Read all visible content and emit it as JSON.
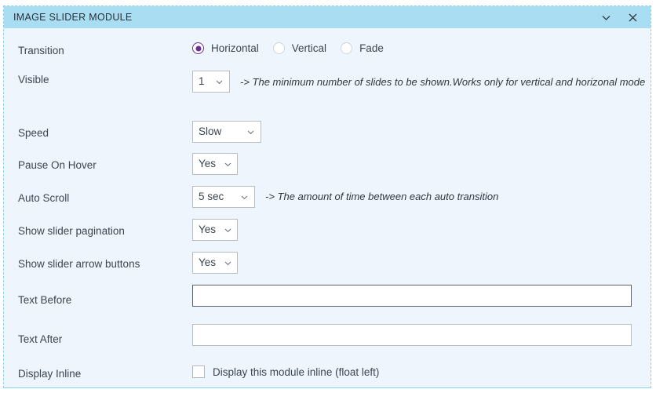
{
  "panel": {
    "title": "IMAGE SLIDER MODULE",
    "header_bg": "#a8ddf2",
    "body_bg": "#eef5fd",
    "border_color": "#8ed2ef",
    "accent_color": "#6d2f8f",
    "actions": [
      {
        "name": "collapse-icon",
        "glyph": "chevron-down"
      },
      {
        "name": "close-icon",
        "glyph": "close-x"
      }
    ]
  },
  "rows": {
    "transition": {
      "label": "Transition",
      "options": [
        {
          "label": "Horizontal",
          "checked": true
        },
        {
          "label": "Vertical",
          "checked": false
        },
        {
          "label": "Fade",
          "checked": false
        }
      ]
    },
    "visible": {
      "label": "Visible",
      "value": "1",
      "help": "-> The minimum number of slides to be shown.Works only for vertical and horizonal mode"
    },
    "speed": {
      "label": "Speed",
      "value": "Slow"
    },
    "pause_on_hover": {
      "label": "Pause On Hover",
      "value": "Yes"
    },
    "auto_scroll": {
      "label": "Auto Scroll",
      "value": "5 sec",
      "help": "-> The amount of time between each auto transition"
    },
    "show_pagination": {
      "label": "Show slider pagination",
      "value": "Yes"
    },
    "show_arrows": {
      "label": "Show slider arrow buttons",
      "value": "Yes"
    },
    "text_before": {
      "label": "Text Before",
      "value": "",
      "placeholder": ""
    },
    "text_after": {
      "label": "Text After",
      "value": "",
      "placeholder": ""
    },
    "display_inline": {
      "label": "Display Inline",
      "checkbox_label": "Display this module inline (float left)",
      "checked": false
    }
  }
}
